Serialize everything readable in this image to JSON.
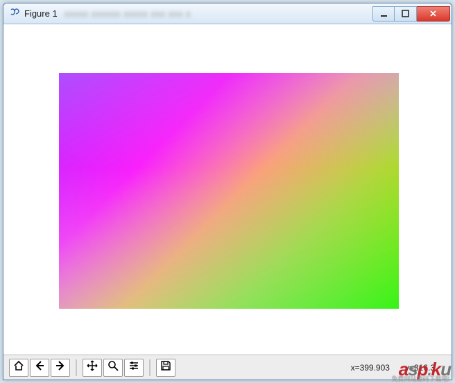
{
  "window": {
    "title": "Figure 1",
    "blurred_extra": "xxxxx xxxxxx xxxxx  xxx  xxx  x"
  },
  "toolbar": {
    "coord_x_label": "x=399.903",
    "coord_y_label": "y=316.3",
    "buttons": {
      "home": "home",
      "back": "back",
      "forward": "forward",
      "pan": "pan",
      "zoom": "zoom",
      "configure": "configure",
      "save": "save"
    }
  },
  "watermark": {
    "brand_a": "a",
    "brand_s": "s",
    "brand_p": "p",
    "brand_dot": ".",
    "brand_k": "k",
    "brand_u": "u",
    "subtext": "免费网站源码下载吧!"
  }
}
